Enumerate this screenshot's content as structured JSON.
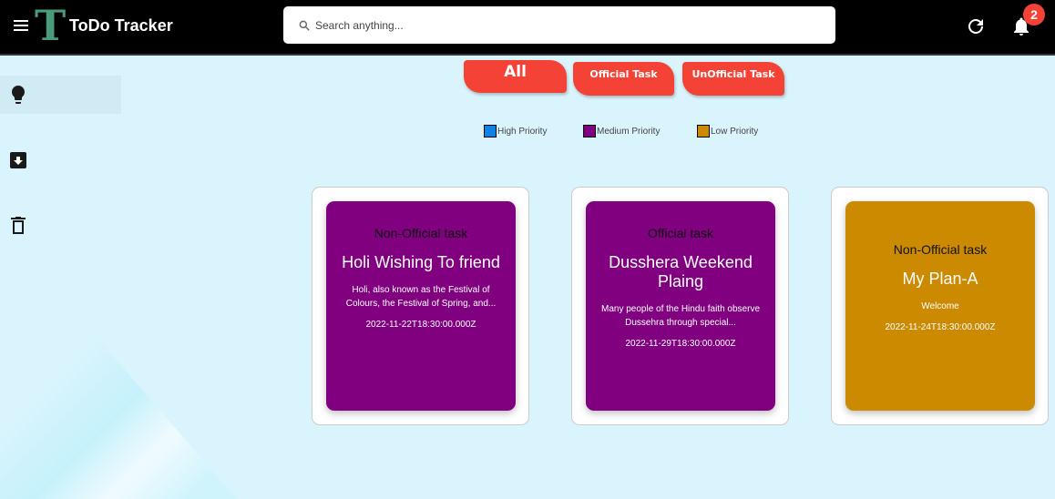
{
  "header": {
    "app_title": "ToDo Tracker",
    "logo_letter": "T",
    "search_placeholder": "Search anything...",
    "notification_count": "2"
  },
  "sidebar": {
    "items": [
      {
        "name": "notes",
        "icon": "lightbulb-icon",
        "active": true
      },
      {
        "name": "archive",
        "icon": "archive-icon"
      },
      {
        "name": "trash",
        "icon": "trash-icon"
      }
    ]
  },
  "tabs": [
    {
      "label": "All"
    },
    {
      "label": "Official Task"
    },
    {
      "label": "UnOfficial Task"
    }
  ],
  "legend": [
    {
      "label": "High Priority",
      "color": "#1182e6"
    },
    {
      "label": "Medium Priority",
      "color": "#800080"
    },
    {
      "label": "Low Priority",
      "color": "#cb8a00"
    }
  ],
  "cards": [
    {
      "type": "Non-Official task",
      "title": "Holi Wishing To friend",
      "description": "Holi, also known as the Festival of Colours, the Festival of Spring, and...",
      "date": "2022-11-22T18:30:00.000Z",
      "color": "#800080"
    },
    {
      "type": "Official task",
      "title": "Dusshera Weekend Plaing",
      "description": "Many people of the Hindu faith observe Dussehra through special...",
      "date": "2022-11-29T18:30:00.000Z",
      "color": "#800080"
    },
    {
      "type": "Non-Official task",
      "title": "My Plan-A",
      "description": "Welcome",
      "date": "2022-11-24T18:30:00.000Z",
      "color": "#cb8a00"
    }
  ]
}
